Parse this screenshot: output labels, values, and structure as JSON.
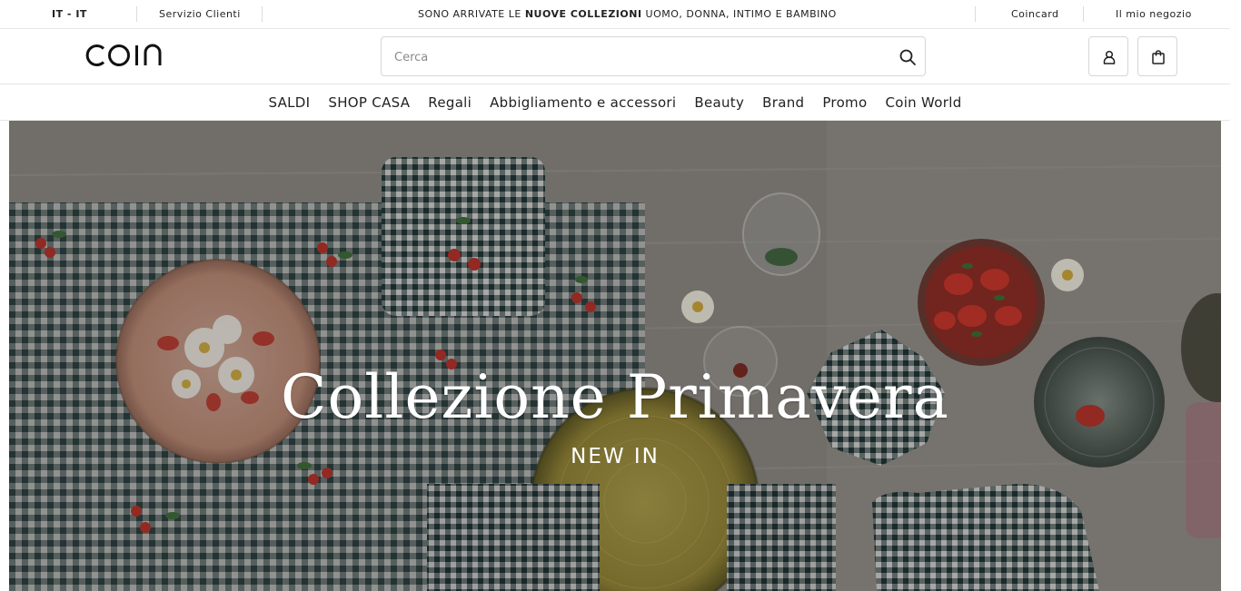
{
  "topbar": {
    "language": "IT - IT",
    "customer_service": "Servizio Clienti",
    "promo_prefix": "SONO ARRIVATE LE ",
    "promo_bold": "NUOVE COLLEZIONI",
    "promo_suffix": " UOMO, DONNA, INTIMO E BAMBINO",
    "coincard": "Coincard",
    "my_store": "Il mio negozio"
  },
  "header": {
    "logo": "COIN",
    "search": {
      "placeholder": "Cerca",
      "icon": "search-icon"
    },
    "account_icon": "user-icon",
    "bag_icon": "shopping-bag-icon"
  },
  "nav": {
    "items": [
      "SALDI",
      "SHOP CASA",
      "Regali",
      "Abbigliamento e accessori",
      "Beauty",
      "Brand",
      "Promo",
      "Coin World"
    ]
  },
  "hero": {
    "title": "Collezione Primavera",
    "subtitle": "NEW IN"
  },
  "colors": {
    "hero_overlay": "#6f6c68",
    "gingham_dark": "#2f4a4a",
    "text": "#222222"
  }
}
